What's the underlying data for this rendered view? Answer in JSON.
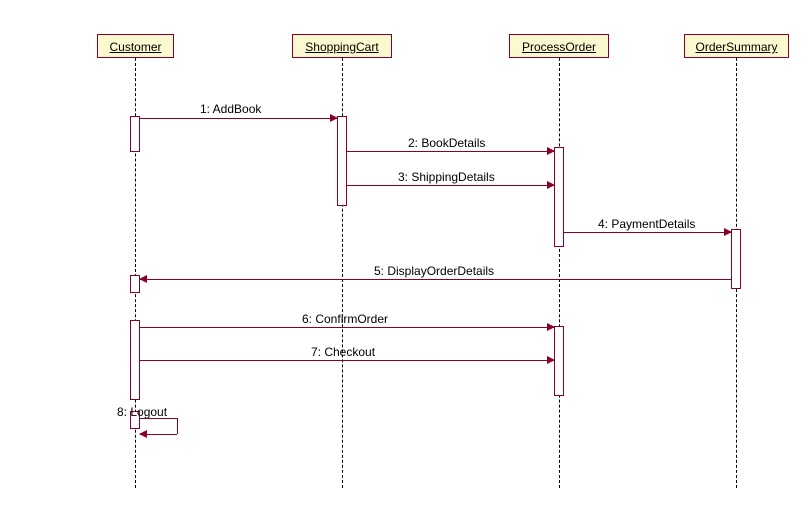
{
  "participants": {
    "customer": "Customer",
    "cart": "ShoppingCart",
    "process": "ProcessOrder",
    "summary": "OrderSummary"
  },
  "messages": {
    "m1": "1: AddBook",
    "m2": "2: BookDetails",
    "m3": "3: ShippingDetails",
    "m4": "4: PaymentDetails",
    "m5": "5: DisplayOrderDetails",
    "m6": "6: ConfirmOrder",
    "m7": "7: Checkout",
    "m8": "8: Logout"
  },
  "chart_data": {
    "type": "sequence-diagram",
    "participants": [
      "Customer",
      "ShoppingCart",
      "ProcessOrder",
      "OrderSummary"
    ],
    "messages": [
      {
        "n": 1,
        "from": "Customer",
        "to": "ShoppingCart",
        "label": "AddBook"
      },
      {
        "n": 2,
        "from": "ShoppingCart",
        "to": "ProcessOrder",
        "label": "BookDetails"
      },
      {
        "n": 3,
        "from": "ShoppingCart",
        "to": "ProcessOrder",
        "label": "ShippingDetails"
      },
      {
        "n": 4,
        "from": "ProcessOrder",
        "to": "OrderSummary",
        "label": "PaymentDetails"
      },
      {
        "n": 5,
        "from": "OrderSummary",
        "to": "Customer",
        "label": "DisplayOrderDetails"
      },
      {
        "n": 6,
        "from": "Customer",
        "to": "ProcessOrder",
        "label": "ConfirmOrder"
      },
      {
        "n": 7,
        "from": "Customer",
        "to": "ProcessOrder",
        "label": "Checkout"
      },
      {
        "n": 8,
        "from": "Customer",
        "to": "Customer",
        "label": "Logout"
      }
    ]
  }
}
